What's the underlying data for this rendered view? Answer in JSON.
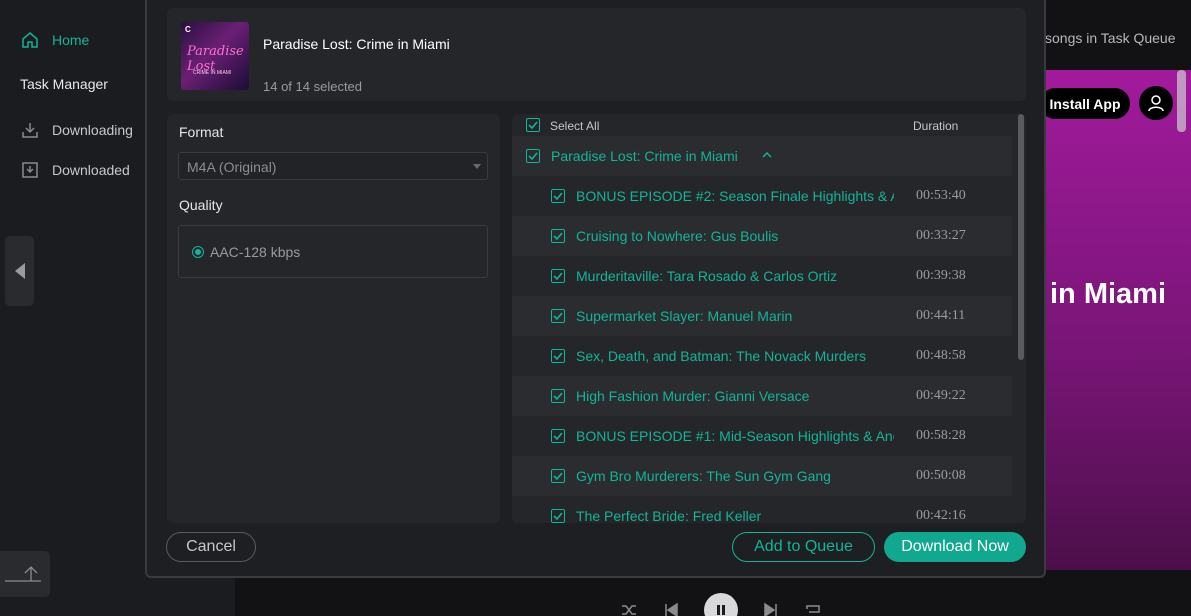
{
  "sidebar": {
    "home_label": "Home",
    "section_title": "Task Manager",
    "downloading_label": "Downloading",
    "downloaded_label": "Downloaded"
  },
  "background": {
    "queue_text": "songs in Task Queue",
    "install_label": "Install App",
    "banner_title": "in Miami"
  },
  "dialog": {
    "album_title": "Paradise Lost: Crime in Miami",
    "selected_text": "14 of 14 selected",
    "cover": {
      "top_mark": "C",
      "title": "Paradise Lost",
      "subtitle": "CRIME IN MIAMI"
    },
    "format_label": "Format",
    "format_value": "M4A (Original)",
    "quality_label": "Quality",
    "quality_option": "AAC-128 kbps",
    "select_all_label": "Select All",
    "duration_header": "Duration",
    "group_title": "Paradise Lost: Crime in Miami",
    "tracks": [
      {
        "title": "BONUS EPISODE #2: Season Finale Highlights & A",
        "duration": "00:53:40"
      },
      {
        "title": "Cruising to Nowhere: Gus Boulis",
        "duration": "00:33:27"
      },
      {
        "title": "Murderitaville: Tara Rosado & Carlos Ortiz",
        "duration": "00:39:38"
      },
      {
        "title": "Supermarket Slayer: Manuel Marin",
        "duration": "00:44:11"
      },
      {
        "title": "Sex, Death, and Batman: The Novack Murders",
        "duration": "00:48:58"
      },
      {
        "title": "High Fashion Murder: Gianni Versace",
        "duration": "00:49:22"
      },
      {
        "title": "BONUS EPISODE #1: Mid-Season Highlights & Ane",
        "duration": "00:58:28"
      },
      {
        "title": "Gym Bro Murderers: The Sun Gym Gang",
        "duration": "00:50:08"
      },
      {
        "title": "The Perfect Bride: Fred Keller",
        "duration": "00:42:16"
      }
    ],
    "cancel_label": "Cancel",
    "queue_label": "Add to Queue",
    "download_label": "Download Now"
  },
  "colors": {
    "accent": "#10b59a",
    "dialog_bg": "#1e1f22",
    "panel_bg": "#25262a",
    "banner": "#a21a9c"
  }
}
